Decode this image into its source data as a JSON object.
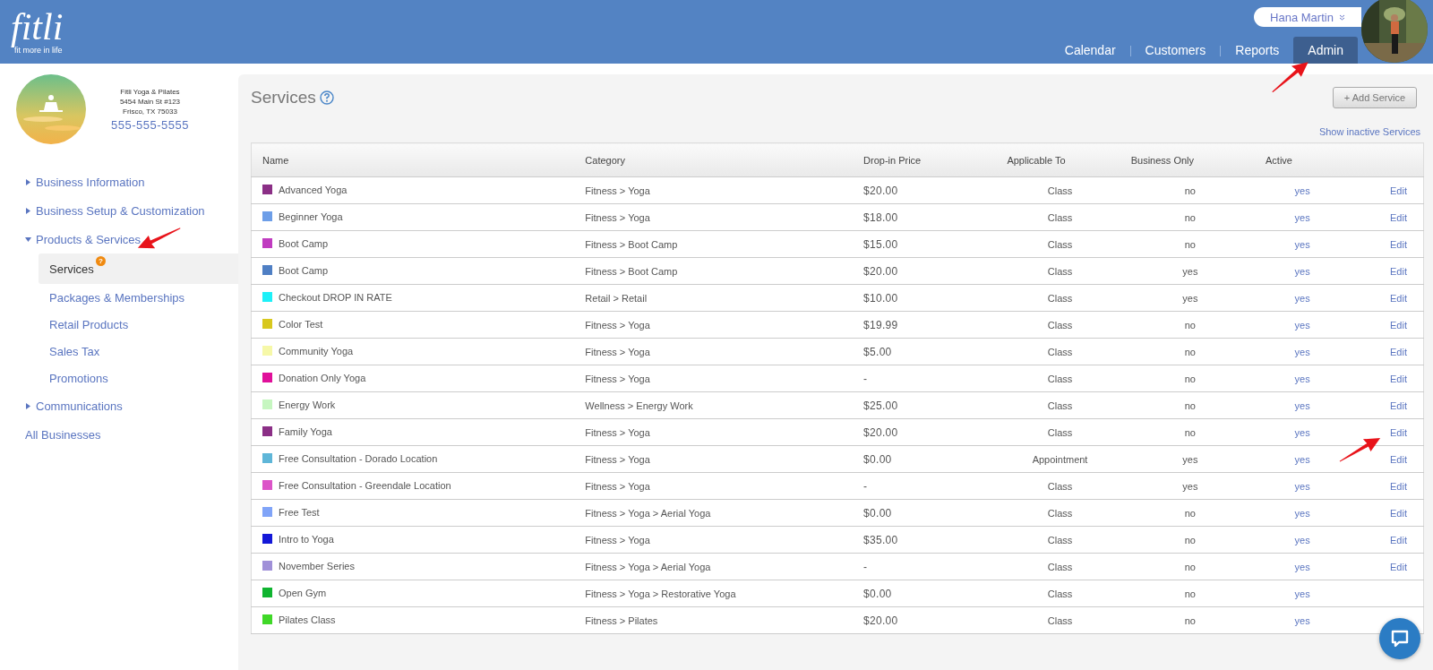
{
  "header": {
    "logo": {
      "wordmark": "fitli",
      "tagline": "fit more in life"
    },
    "user": {
      "name": "Hana Martin"
    },
    "nav": [
      {
        "label": "Calendar",
        "selected": false
      },
      {
        "label": "Customers",
        "selected": false
      },
      {
        "label": "Reports",
        "selected": false
      },
      {
        "label": "Admin",
        "selected": true,
        "annotated": true
      }
    ]
  },
  "business": {
    "name": "Fitli Yoga & Pilates",
    "address": "5454 Main St #123",
    "city": "Frisco, TX 75033",
    "phone": "555-555-5555"
  },
  "sidebar": {
    "items": [
      {
        "kind": "section",
        "label": "Business Information",
        "expanded": false
      },
      {
        "kind": "section",
        "label": "Business Setup & Customization",
        "expanded": false
      },
      {
        "kind": "section",
        "label": "Products & Services",
        "expanded": true,
        "annotated": true,
        "children": [
          {
            "label": "Services",
            "selected": true,
            "badge": "?"
          },
          {
            "label": "Packages & Memberships",
            "selected": false
          },
          {
            "label": "Retail Products",
            "selected": false
          },
          {
            "label": "Sales Tax",
            "selected": false
          },
          {
            "label": "Promotions",
            "selected": false
          }
        ]
      },
      {
        "kind": "section",
        "label": "Communications",
        "expanded": false
      },
      {
        "kind": "link",
        "label": "All Businesses"
      }
    ]
  },
  "page": {
    "title": "Services",
    "add_button": "+ Add Service",
    "show_inactive": "Show inactive Services"
  },
  "table": {
    "columns": [
      "Name",
      "Category",
      "Drop-in Price",
      "Applicable To",
      "Business Only",
      "Active"
    ],
    "rows": [
      {
        "name": "Advanced Yoga",
        "color": "#8b2f86",
        "category": "Fitness > Yoga",
        "price": "$20.00",
        "applicable_to": "Class",
        "business_only": "no",
        "active": "yes",
        "edit": "Edit"
      },
      {
        "name": "Beginner Yoga",
        "color": "#6d9ee8",
        "category": "Fitness > Yoga",
        "price": "$18.00",
        "applicable_to": "Class",
        "business_only": "no",
        "active": "yes",
        "edit": "Edit"
      },
      {
        "name": "Boot Camp",
        "color": "#c03cc0",
        "category": "Fitness > Boot Camp",
        "price": "$15.00",
        "applicable_to": "Class",
        "business_only": "no",
        "active": "yes",
        "edit": "Edit"
      },
      {
        "name": "Boot Camp",
        "color": "#4f7fc4",
        "category": "Fitness > Boot Camp",
        "price": "$20.00",
        "applicable_to": "Class",
        "business_only": "yes",
        "active": "yes",
        "edit": "Edit"
      },
      {
        "name": "Checkout DROP IN RATE",
        "color": "#1ef0f8",
        "category": "Retail > Retail",
        "price": "$10.00",
        "applicable_to": "Class",
        "business_only": "yes",
        "active": "yes",
        "edit": "Edit"
      },
      {
        "name": "Color Test",
        "color": "#d8c81e",
        "category": "Fitness > Yoga",
        "price": "$19.99",
        "applicable_to": "Class",
        "business_only": "no",
        "active": "yes",
        "edit": "Edit"
      },
      {
        "name": "Community Yoga",
        "color": "#f6f8a8",
        "category": "Fitness > Yoga",
        "price": "$5.00",
        "applicable_to": "Class",
        "business_only": "no",
        "active": "yes",
        "edit": "Edit"
      },
      {
        "name": "Donation Only Yoga",
        "color": "#e0109a",
        "category": "Fitness > Yoga",
        "price": "-",
        "applicable_to": "Class",
        "business_only": "no",
        "active": "yes",
        "edit": "Edit"
      },
      {
        "name": "Energy Work",
        "color": "#c6f6c0",
        "category": "Wellness > Energy Work",
        "price": "$25.00",
        "applicable_to": "Class",
        "business_only": "no",
        "active": "yes",
        "edit": "Edit"
      },
      {
        "name": "Family Yoga",
        "color": "#8b2f86",
        "category": "Fitness > Yoga",
        "price": "$20.00",
        "applicable_to": "Class",
        "business_only": "no",
        "active": "yes",
        "edit": "Edit",
        "annotated": true
      },
      {
        "name": "Free Consultation - Dorado Location",
        "color": "#5fb6d8",
        "category": "Fitness > Yoga",
        "price": "$0.00",
        "applicable_to": "Appointment",
        "business_only": "yes",
        "active": "yes",
        "edit": "Edit"
      },
      {
        "name": "Free Consultation - Greendale Location",
        "color": "#dc54c8",
        "category": "Fitness > Yoga",
        "price": "-",
        "applicable_to": "Class",
        "business_only": "yes",
        "active": "yes",
        "edit": "Edit"
      },
      {
        "name": "Free Test",
        "color": "#80a4f8",
        "category": "Fitness > Yoga > Aerial Yoga",
        "price": "$0.00",
        "applicable_to": "Class",
        "business_only": "no",
        "active": "yes",
        "edit": "Edit"
      },
      {
        "name": "Intro to Yoga",
        "color": "#1418d8",
        "category": "Fitness > Yoga",
        "price": "$35.00",
        "applicable_to": "Class",
        "business_only": "no",
        "active": "yes",
        "edit": "Edit"
      },
      {
        "name": "November Series",
        "color": "#a090d8",
        "category": "Fitness > Yoga > Aerial Yoga",
        "price": "-",
        "applicable_to": "Class",
        "business_only": "no",
        "active": "yes",
        "edit": "Edit"
      },
      {
        "name": "Open Gym",
        "color": "#10b430",
        "category": "Fitness > Yoga > Restorative Yoga",
        "price": "$0.00",
        "applicable_to": "Class",
        "business_only": "no",
        "active": "yes"
      },
      {
        "name": "Pilates Class",
        "color": "#40d828",
        "category": "Fitness > Pilates",
        "price": "$20.00",
        "applicable_to": "Class",
        "business_only": "no",
        "active": "yes"
      }
    ]
  },
  "chat": {
    "kind": "chat"
  }
}
